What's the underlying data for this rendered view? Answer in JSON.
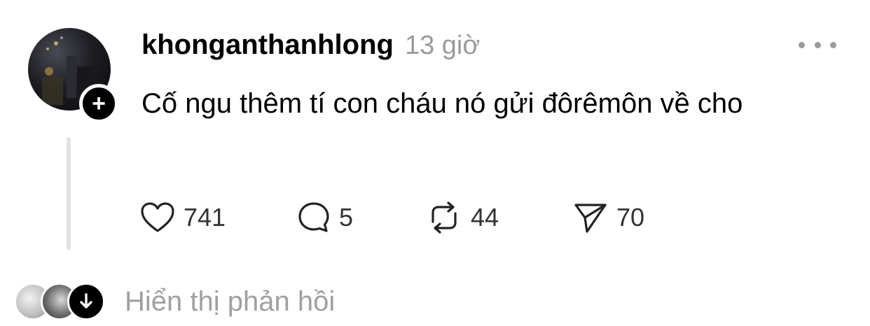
{
  "post": {
    "username": "khonganthanhlong",
    "timestamp": "13 giờ",
    "text": "Cố ngu thêm tí con cháu nó gửi đôrêmôn về cho",
    "follow_symbol": "+"
  },
  "actions": {
    "likes": "741",
    "comments": "5",
    "reposts": "44",
    "shares": "70"
  },
  "replies": {
    "label": "Hiển thị phản hồi"
  },
  "icons": {
    "like": "heart-icon",
    "comment": "speech-bubble-icon",
    "repost": "repost-icon",
    "share": "send-icon",
    "more": "more-dots-icon",
    "follow": "plus-icon",
    "expand": "arrow-down-icon"
  }
}
